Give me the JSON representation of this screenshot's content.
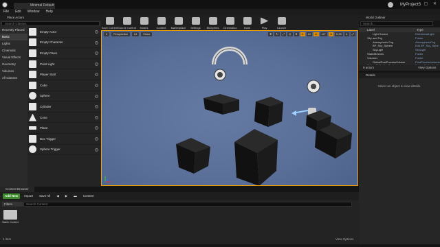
{
  "window": {
    "tab_label": "Minimal Default",
    "project_name": "MyProject3",
    "controls": "‒ ▢ ✕"
  },
  "menu": [
    "File",
    "Edit",
    "Window",
    "Help"
  ],
  "modes": {
    "header": "Place Actors",
    "search_placeholder": "Search Classes",
    "categories": [
      "Recently Placed",
      "Basic",
      "Lights",
      "Cinematic",
      "Visual Effects",
      "Geometry",
      "Volumes",
      "All Classes"
    ],
    "active_category": "Basic",
    "items": [
      "Empty Actor",
      "Empty Character",
      "Empty Pawn",
      "Point Light",
      "Player Start",
      "Cube",
      "Sphere",
      "Cylinder",
      "Cone",
      "Plane",
      "Box Trigger",
      "Sphere Trigger"
    ]
  },
  "toolbar": [
    "Save Current",
    "Source Control",
    "Modes",
    "Content",
    "Marketplace",
    "Settings",
    "Blueprints",
    "Cinematics",
    "Build",
    "Play",
    "Launch"
  ],
  "viewport": {
    "view_mode": "Perspective",
    "lighting": "Lit",
    "show": "Show",
    "grid_snap": "10",
    "rot_snap": "10°",
    "scale_snap": "0.25",
    "camera_speed": "4"
  },
  "content_browser": {
    "tab_label": "Content Browser",
    "add_new": "Add New",
    "import": "Import",
    "save_all": "Save All",
    "path": "Content",
    "filters": "Filters",
    "search_placeholder": "Search Content",
    "folder_label": "Starter Content",
    "item_count": "1 item",
    "view_options": "View Options"
  },
  "outliner": {
    "tab_label": "World Outliner",
    "search_placeholder": "Search...",
    "col_label": "Label",
    "col_type": "Type",
    "rows": [
      {
        "label": "Light Source",
        "type": "DirectionalLight"
      },
      {
        "label": "Sky and Fog",
        "type": "Folder"
      },
      {
        "label": "Atmospheric Fog",
        "type": "AtmosphericFog"
      },
      {
        "label": "BP_Sky_Sphere",
        "type": "Edit BP_Sky_Sphe"
      },
      {
        "label": "SkyLight",
        "type": "SkyLight"
      },
      {
        "label": "StaticMeshes",
        "type": "Folder"
      },
      {
        "label": "Volumes",
        "type": "Folder"
      },
      {
        "label": "GlobalPostProcessVolume",
        "type": "PostProcessVolume"
      },
      {
        "label": "SphereReflectionCapture",
        "type": "SphereReflectionCa"
      }
    ],
    "actor_count": "9 actors",
    "view_options": "View Options"
  },
  "details": {
    "tab_label": "Details",
    "empty_message": "Select an object to view details."
  }
}
